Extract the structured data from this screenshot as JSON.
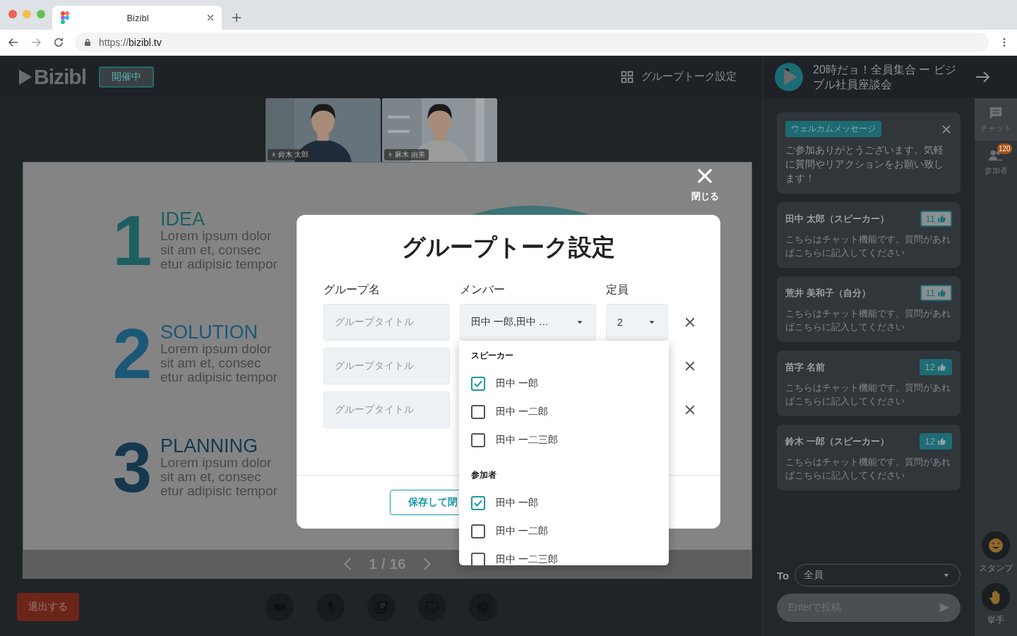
{
  "browser": {
    "tab_title": "Bizibl",
    "url_scheme": "https://",
    "url_host": "bizibl.tv"
  },
  "header": {
    "logo": "Bizibl",
    "status_badge": "開催中",
    "group_talk_button": "グループトーク設定"
  },
  "event": {
    "title": "20時だョ！全員集合 ー ビジブル社員座談会"
  },
  "videos": [
    {
      "name": "鈴木 太郎"
    },
    {
      "name": "麻木 由美"
    }
  ],
  "slide": {
    "items": [
      {
        "number": "1",
        "title": "IDEA",
        "lines": [
          "Lorem ipsum dolor",
          "sit am et, consec",
          "etur adipisic tempor"
        ],
        "color": "#1d5f61"
      },
      {
        "number": "2",
        "title": "SOLUTION",
        "lines": [
          "Lorem ipsum dolor",
          "sit am et, consec",
          "etur adipisic tempor"
        ],
        "color": "#1b5878"
      },
      {
        "number": "3",
        "title": "PLANNING",
        "lines": [
          "Lorem ipsum dolor",
          "sit am et, consec",
          "etur adipisic tempor"
        ],
        "color": "#15384f"
      }
    ],
    "page": "1 / 16"
  },
  "leave_button": "退出する",
  "modal": {
    "close_label": "閉じる",
    "title": "グループトーク設定",
    "columns": [
      "グループ名",
      "メンバー",
      "定員"
    ],
    "rows": [
      {
        "placeholder": "グループタイトル",
        "members": "田中 一郎,田中 …",
        "capacity": "2"
      },
      {
        "placeholder": "グループタイトル"
      },
      {
        "placeholder": "グループタイトル"
      }
    ],
    "save_button": "保存して閉"
  },
  "member_dropdown": {
    "sections": [
      {
        "heading": "スピーカー",
        "options": [
          {
            "label": "田中 一郎",
            "checked": true
          },
          {
            "label": "田中 一二郎",
            "checked": false
          },
          {
            "label": "田中 一二三郎",
            "checked": false
          }
        ]
      },
      {
        "heading": "参加者",
        "options": [
          {
            "label": "田中 一郎",
            "checked": true
          },
          {
            "label": "田中 一二郎",
            "checked": false
          },
          {
            "label": "田中 一二三郎",
            "checked": false
          }
        ]
      }
    ]
  },
  "chat": {
    "welcome": {
      "tag": "ウェルカムメッセージ",
      "text": "ご参加ありがとうございます。気軽に質問やリアクションをお願い致します！"
    },
    "messages": [
      {
        "author": "田中 太郎（スピーカー）",
        "likes": "11",
        "liked": false,
        "text": "こちらはチャット機能です。質問があればこちらに記入してください"
      },
      {
        "author": "荒井 美和子（自分）",
        "likes": "11",
        "liked": false,
        "text": "こちらはチャット機能です。質問があればこちらに記入してください"
      },
      {
        "author": "苗字 名前",
        "likes": "12",
        "liked": true,
        "text": "こちらはチャット機能です。質問があればこちらに記入してください"
      },
      {
        "author": "鈴木 一郎（スピーカー）",
        "likes": "12",
        "liked": true,
        "text": "こちらはチャット機能です。質問があればこちらに記入してください"
      }
    ],
    "to_label": "To",
    "recipient": "全員",
    "input_placeholder": "Enterで投稿"
  },
  "rail": {
    "items": [
      {
        "kind": "chat",
        "label": "チャット",
        "selected": true
      },
      {
        "kind": "participants",
        "label": "参加者",
        "selected": false,
        "badge": "120"
      }
    ],
    "actions": [
      {
        "kind": "stamp",
        "label": "スタンプ"
      },
      {
        "kind": "hand",
        "label": "挙手"
      }
    ]
  }
}
